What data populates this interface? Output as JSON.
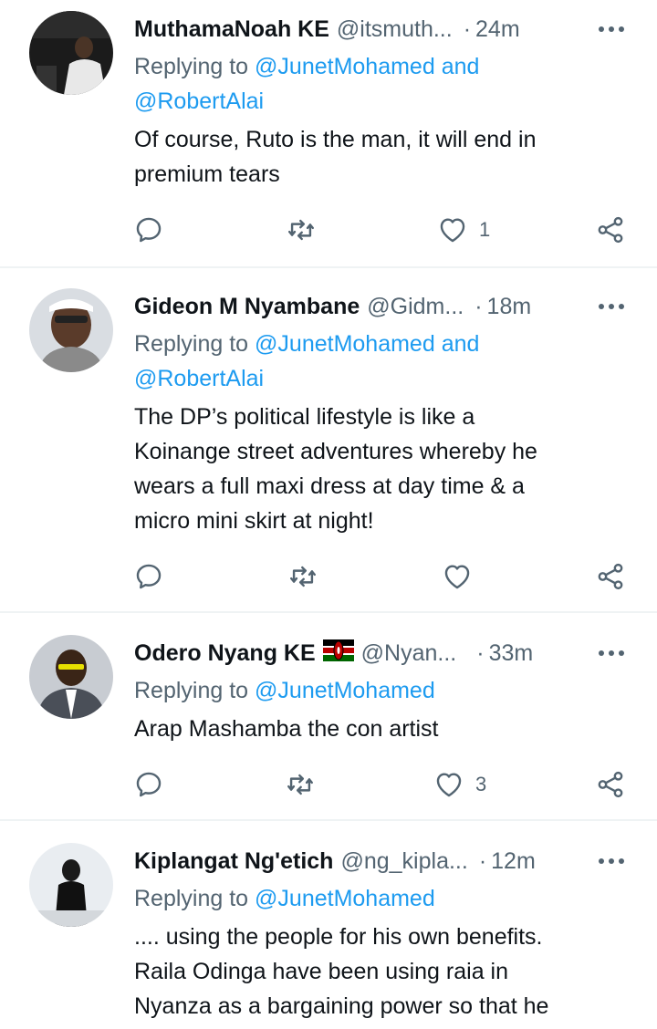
{
  "tweets": [
    {
      "name": "MuthamaNoah KE",
      "handle": "@itsmuth...",
      "separator": "·",
      "time": "24m",
      "reply_prefix": "Replying to",
      "reply_mentions": [
        "@JunetMohamed",
        "@RobertAlai"
      ],
      "reply_joiner": "and",
      "text_lines": [
        "Of course, Ruto is the man, it will end in",
        "premium tears"
      ],
      "like_count": "1",
      "has_flag": false
    },
    {
      "name": "Gideon M Nyambane",
      "handle": "@Gidm...",
      "separator": "·",
      "time": "18m",
      "reply_prefix": "Replying to",
      "reply_mentions": [
        "@JunetMohamed",
        "@RobertAlai"
      ],
      "reply_joiner": "and",
      "text_lines": [
        "The DP’s political lifestyle is like a",
        "Koinange street adventures whereby he",
        "wears a full maxi dress at day time & a",
        "micro mini skirt at night!"
      ],
      "like_count": "",
      "has_flag": false
    },
    {
      "name": "Odero Nyang KE",
      "handle": "@Nyan...",
      "separator": "·",
      "time": "33m",
      "reply_prefix": "Replying to",
      "reply_mentions": [
        "@JunetMohamed"
      ],
      "reply_joiner": "",
      "text_lines": [
        "Arap Mashamba the con artist"
      ],
      "like_count": "3",
      "has_flag": true
    },
    {
      "name": "Kiplangat Ng'etich",
      "handle": "@ng_kipla...",
      "separator": "·",
      "time": "12m",
      "reply_prefix": "Replying to",
      "reply_mentions": [
        "@JunetMohamed"
      ],
      "reply_joiner": "",
      "text_lines": [
        ".... using the people for his own benefits.",
        "Raila Odinga have been using raia in",
        "Nyanza as a bargaining power so that he"
      ],
      "like_count": "",
      "has_flag": false
    }
  ],
  "icons": {
    "reply": "reply-icon",
    "retweet": "retweet-icon",
    "like": "heart-icon",
    "share": "share-icon",
    "more": "more-icon",
    "flag": "kenya-flag-icon"
  },
  "colors": {
    "link": "#1d9bf0",
    "secondary": "#536471",
    "text": "#0f1419",
    "divider": "#eff3f4"
  }
}
